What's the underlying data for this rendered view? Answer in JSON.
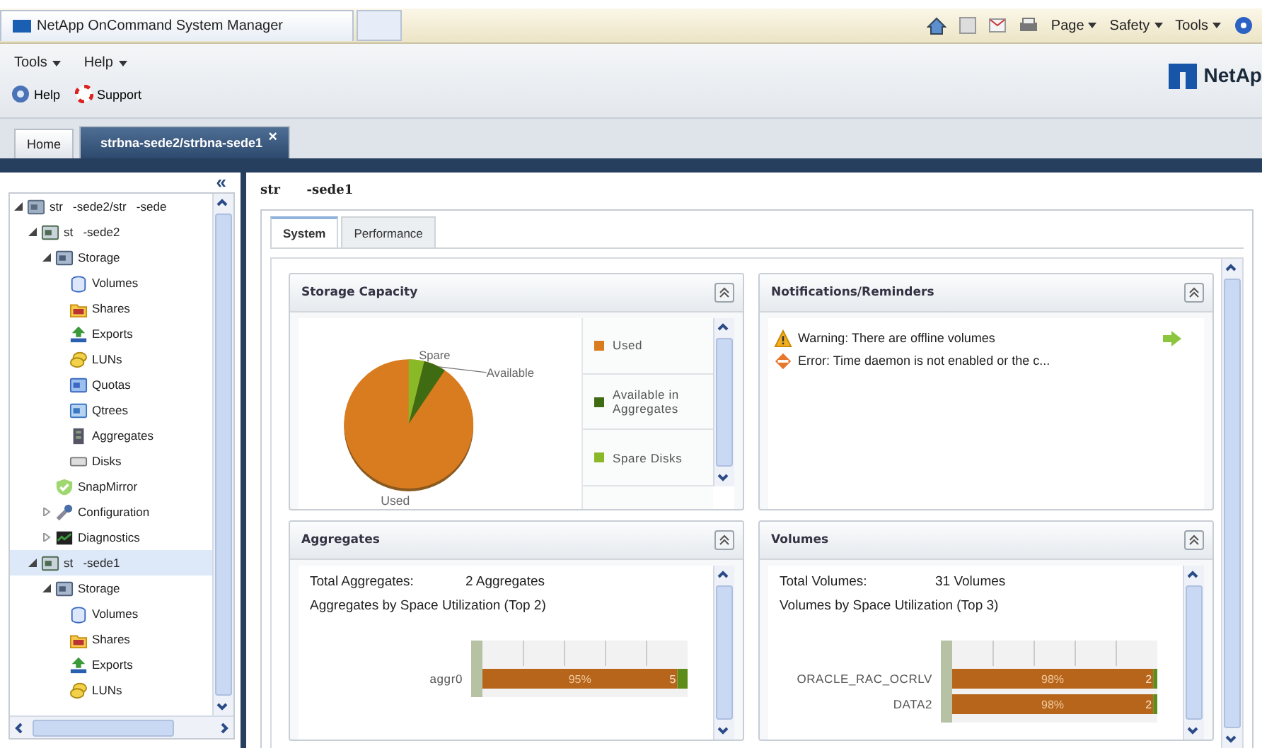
{
  "browser": {
    "tab_title": "NetApp OnCommand System Manager",
    "menus": [
      "Page",
      "Safety",
      "Tools"
    ]
  },
  "menu": [
    "Tools",
    "Help"
  ],
  "toolbar": [
    {
      "kind": "help",
      "label": "Help"
    },
    {
      "kind": "support",
      "label": "Support"
    }
  ],
  "logo": "NetAp",
  "tabs": [
    {
      "label": "Home",
      "selected": false
    },
    {
      "label": "strbna-sede2/strbna-sede1",
      "selected": true,
      "close": "×"
    }
  ],
  "tree": {
    "collapse": "«",
    "items": [
      {
        "kind": "cluster",
        "label": "str   -sede2/str   -sede",
        "expanded": true,
        "selected": false,
        "children": [
          {
            "kind": "node",
            "label": "st   -sede2",
            "expanded": true,
            "selected": false,
            "children": [
              {
                "kind": "storage",
                "label": "Storage",
                "expanded": true,
                "selected": false,
                "children": [
                  {
                    "kind": "volume",
                    "label": "Volumes",
                    "selected": false
                  },
                  {
                    "kind": "share",
                    "label": "Shares",
                    "selected": false
                  },
                  {
                    "kind": "export",
                    "label": "Exports",
                    "selected": false
                  },
                  {
                    "kind": "lun",
                    "label": "LUNs",
                    "selected": false
                  },
                  {
                    "kind": "quota",
                    "label": "Quotas",
                    "selected": false
                  },
                  {
                    "kind": "qtree",
                    "label": "Qtrees",
                    "selected": false
                  },
                  {
                    "kind": "aggregate",
                    "label": "Aggregates",
                    "selected": false
                  },
                  {
                    "kind": "disk",
                    "label": "Disks",
                    "selected": false
                  }
                ]
              },
              {
                "kind": "snapmirror",
                "label": "SnapMirror",
                "selected": false
              },
              {
                "kind": "config",
                "label": "Configuration",
                "expanded": false,
                "selected": false
              },
              {
                "kind": "diag",
                "label": "Diagnostics",
                "expanded": false,
                "selected": false
              }
            ]
          },
          {
            "kind": "node",
            "label": "st   -sede1",
            "expanded": true,
            "selected": true,
            "children": [
              {
                "kind": "storage",
                "label": "Storage",
                "expanded": true,
                "selected": false,
                "children": [
                  {
                    "kind": "volume",
                    "label": "Volumes",
                    "selected": false
                  },
                  {
                    "kind": "share",
                    "label": "Shares",
                    "selected": false
                  },
                  {
                    "kind": "export",
                    "label": "Exports",
                    "selected": false
                  },
                  {
                    "kind": "lun",
                    "label": "LUNs",
                    "selected": false
                  }
                ]
              }
            ]
          }
        ]
      }
    ]
  },
  "main": {
    "title": "str      -sede1",
    "tabs": [
      {
        "label": "System",
        "selected": true
      },
      {
        "label": "Performance",
        "selected": false
      }
    ]
  },
  "storage_capacity": {
    "title": "Storage Capacity",
    "pie_labels": [
      "Spare",
      "Available",
      "Used"
    ],
    "legend": [
      {
        "label": "Used",
        "color": "#d97b1f"
      },
      {
        "label": "Available in Aggregates",
        "color": "#3f6b12"
      },
      {
        "label": "Spare Disks",
        "color": "#8ab927"
      }
    ]
  },
  "notifications": {
    "title": "Notifications/Reminders",
    "items": [
      {
        "kind": "warning",
        "text": "Warning: There are offline volumes",
        "action": true
      },
      {
        "kind": "error",
        "text": "Error: Time daemon is not enabled or the c...",
        "action": false
      }
    ]
  },
  "aggregates": {
    "title": "Aggregates",
    "total_label": "Total Aggregates:",
    "total_value": "2 Aggregates",
    "subtitle": "Aggregates by Space Utilization (Top 2)",
    "chart_data": {
      "type": "bar",
      "orientation": "horizontal",
      "stacked": true,
      "categories": [
        "aggr0"
      ],
      "series": [
        {
          "color": "#b8651c",
          "values": [
            95
          ],
          "value_labels": [
            "95%"
          ]
        },
        {
          "color": "#5e8c1a",
          "values": [
            5
          ],
          "value_labels": [
            "5"
          ]
        }
      ]
    }
  },
  "volumes": {
    "title": "Volumes",
    "total_label": "Total Volumes:",
    "total_value": "31 Volumes",
    "subtitle": "Volumes by Space Utilization (Top 3)",
    "chart_data": {
      "type": "bar",
      "orientation": "horizontal",
      "stacked": true,
      "categories": [
        "ORACLE_RAC_OCRLV",
        "DATA2"
      ],
      "series": [
        {
          "color": "#b8651c",
          "values": [
            98,
            98
          ],
          "value_labels": [
            "98%",
            "98%"
          ]
        },
        {
          "color": "#5e8c1a",
          "values": [
            2,
            2
          ],
          "value_labels": [
            "2",
            "2"
          ]
        }
      ]
    }
  }
}
